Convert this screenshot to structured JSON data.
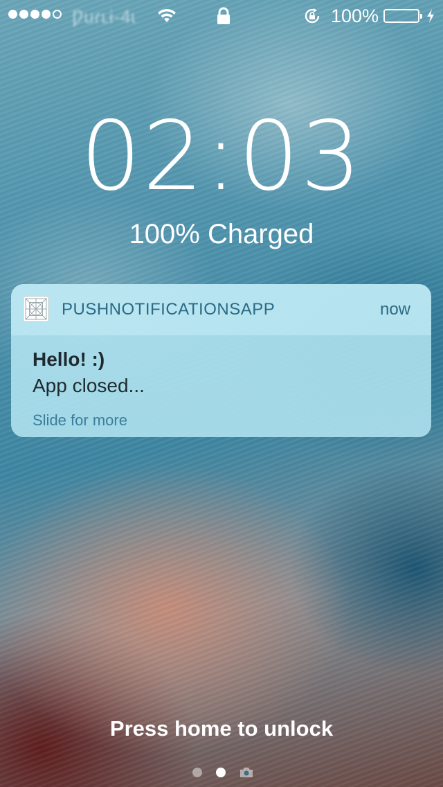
{
  "status_bar": {
    "signal_bars_filled": 4,
    "signal_bars_total": 5,
    "carrier": "Ƿuɾʟɨ-4ɩ",
    "wifi_icon": "wifi-icon",
    "lock_icon": "lock-icon",
    "rotation_icon": "rotation-lock-icon",
    "battery_percent": "100%",
    "battery_level": 1.0,
    "charging_icon": "bolt-icon"
  },
  "lock_screen": {
    "time": "02:03",
    "charge_status": "100% Charged"
  },
  "notification": {
    "app_icon": "app-icon",
    "app_name": "PUSHNOTIFICATIONSAPP",
    "time": "now",
    "title": "Hello! :)",
    "body": "App closed...",
    "hint": "Slide for more"
  },
  "bottom": {
    "unlock_text": "Press home to unlock",
    "page_count": 2,
    "current_page": 2,
    "camera_icon": "camera-icon"
  },
  "colors": {
    "notification_text": "#2c6a86",
    "notification_title": "#1f2a30",
    "hint": "#3a7d9b"
  }
}
